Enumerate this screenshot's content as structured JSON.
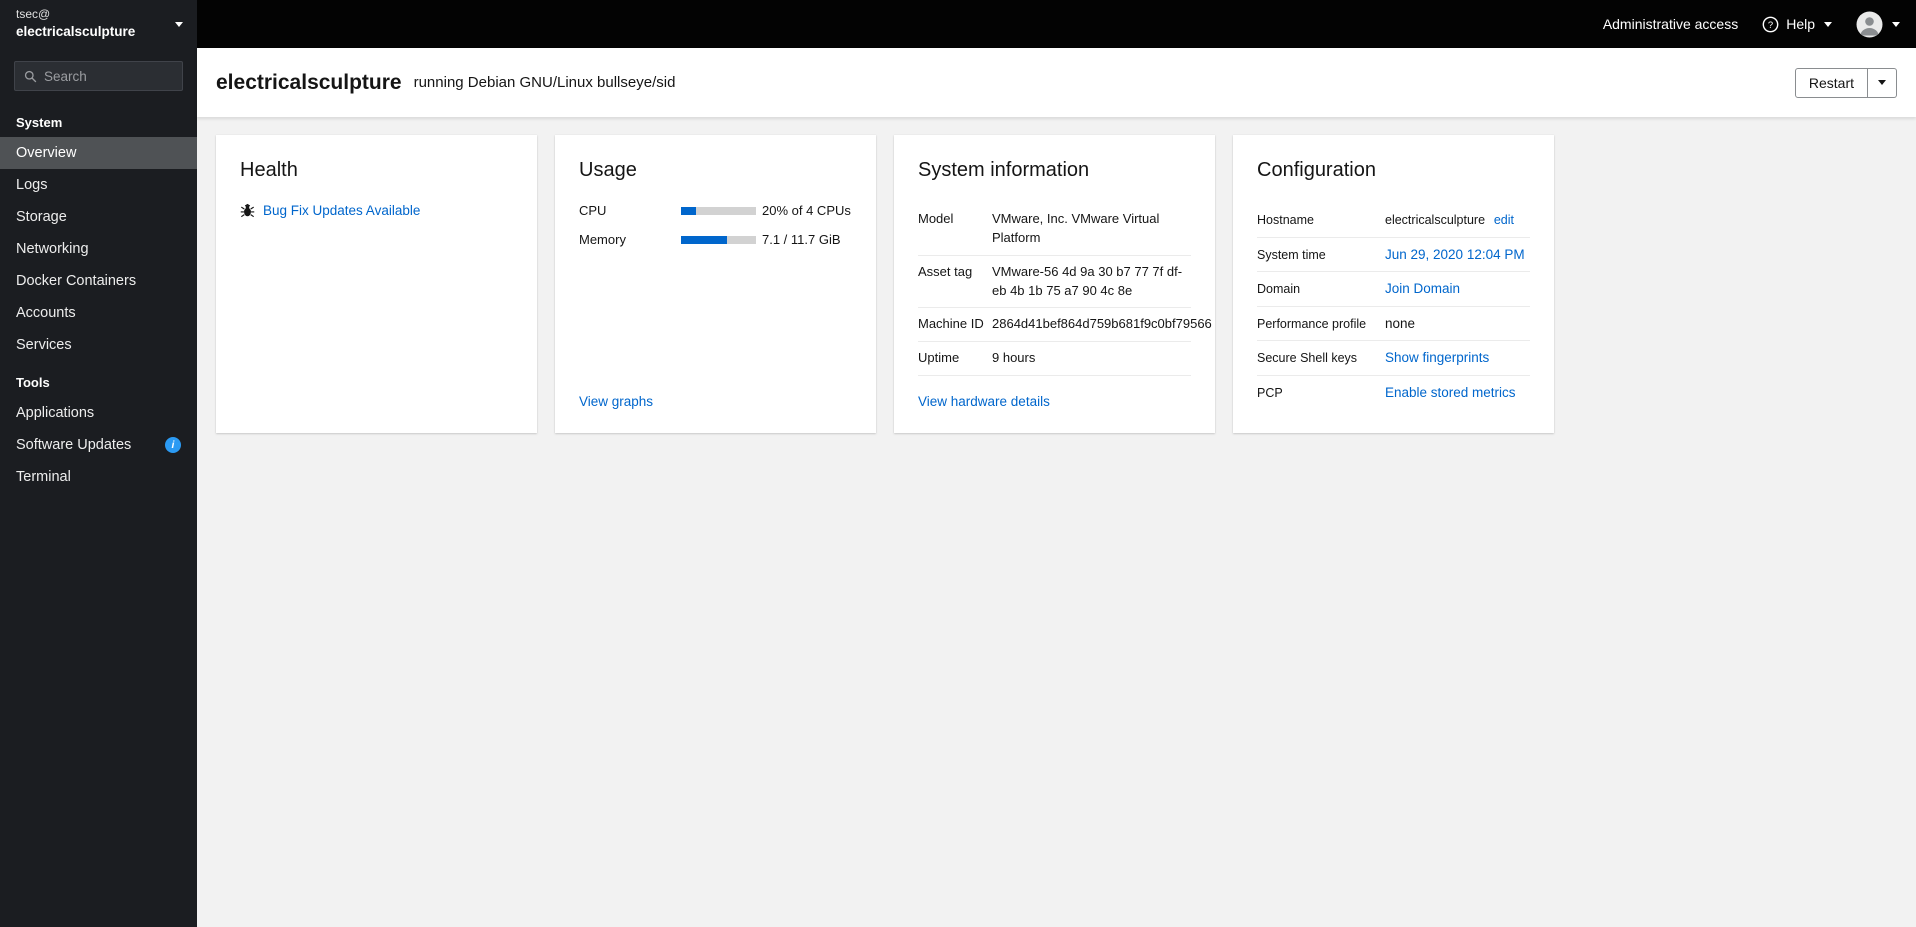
{
  "colors": {
    "link": "#0066cc",
    "progress_fill": "#0066cc",
    "sidebar_bg": "#1b1d21",
    "topbar_bg": "#030303",
    "info_badge": "#2b9af3"
  },
  "sidebar": {
    "user": "tsec@",
    "hostname": "electricalsculpture",
    "search": {
      "placeholder": "Search"
    },
    "sections": [
      {
        "title": "System",
        "items": [
          {
            "label": "Overview",
            "active": true
          },
          {
            "label": "Logs"
          },
          {
            "label": "Storage"
          },
          {
            "label": "Networking"
          },
          {
            "label": "Docker Containers"
          },
          {
            "label": "Accounts"
          },
          {
            "label": "Services"
          }
        ]
      },
      {
        "title": "Tools",
        "items": [
          {
            "label": "Applications"
          },
          {
            "label": "Software Updates",
            "badge": "info"
          },
          {
            "label": "Terminal"
          }
        ]
      }
    ]
  },
  "topbar": {
    "administrative_access": "Administrative access",
    "help": "Help"
  },
  "page_header": {
    "hostname": "electricalsculpture",
    "subtitle": "running Debian GNU/Linux bullseye/sid",
    "restart_label": "Restart"
  },
  "cards": {
    "health": {
      "title": "Health",
      "update_link": "Bug Fix Updates Available"
    },
    "usage": {
      "title": "Usage",
      "rows": [
        {
          "label": "CPU",
          "value": "20% of 4 CPUs",
          "percent": 20
        },
        {
          "label": "Memory",
          "value": "7.1 / 11.7 GiB",
          "percent": 61
        }
      ],
      "footer_link": "View graphs"
    },
    "system_information": {
      "title": "System information",
      "rows": [
        {
          "label": "Model",
          "value": "VMware, Inc. VMware Virtual Platform"
        },
        {
          "label": "Asset tag",
          "value": "VMware-56 4d 9a 30 b7 77 7f df-eb 4b 1b 75 a7 90 4c 8e"
        },
        {
          "label": "Machine ID",
          "value": "2864d41bef864d759b681f9c0bf79566"
        },
        {
          "label": "Uptime",
          "value": "9 hours"
        }
      ],
      "footer_link": "View hardware details"
    },
    "configuration": {
      "title": "Configuration",
      "rows": [
        {
          "label": "Hostname",
          "value": "electricalsculpture",
          "link": "edit"
        },
        {
          "label": "System time",
          "link": "Jun 29, 2020 12:04 PM"
        },
        {
          "label": "Domain",
          "link": "Join Domain"
        },
        {
          "label": "Performance profile",
          "value": "none"
        },
        {
          "label": "Secure Shell keys",
          "link": "Show fingerprints"
        },
        {
          "label": "PCP",
          "link": "Enable stored metrics"
        }
      ]
    }
  }
}
